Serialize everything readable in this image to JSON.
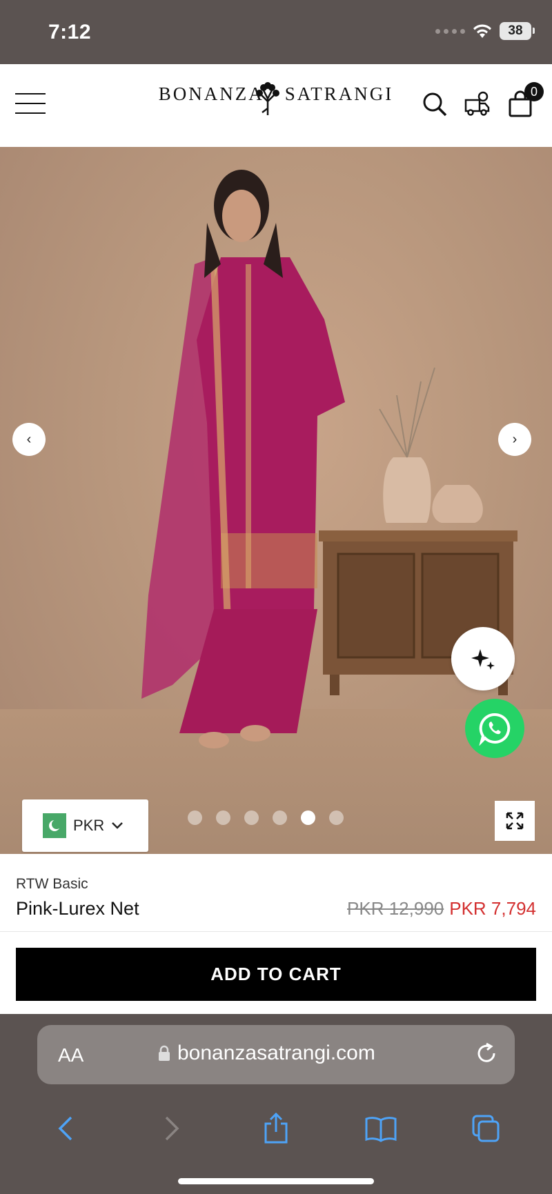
{
  "status_bar": {
    "time": "7:12",
    "battery": "38"
  },
  "header": {
    "logo_left": "BONANZA",
    "logo_right": "SATRANGI",
    "cart_count": "0"
  },
  "gallery": {
    "currency": "PKR",
    "slide_count": 6,
    "active_slide": 5
  },
  "product": {
    "collection": "RTW Basic",
    "name": "Pink-Lurex Net",
    "price_original": "PKR 12,990",
    "price_sale": "PKR 7,794"
  },
  "actions": {
    "add_to_cart": "ADD TO CART"
  },
  "browser": {
    "text_size": "AA",
    "url": "bonanzasatrangi.com"
  },
  "colors": {
    "accent_sale": "#d32f2f",
    "whatsapp": "#25d366",
    "button": "#000000"
  }
}
